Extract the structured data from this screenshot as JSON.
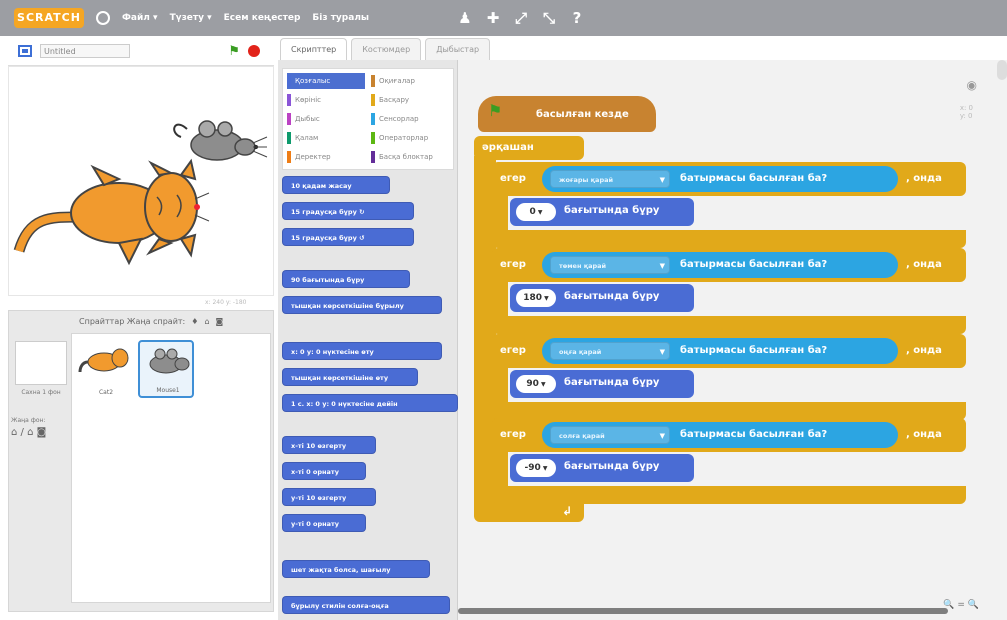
{
  "menubar": {
    "logo": "SCRATCH",
    "items": [
      "Файл ▾",
      "Түзету ▾",
      "Есем кеңестер",
      "Біз туралы"
    ],
    "tool_icons": [
      "duplicate-icon",
      "delete-icon",
      "grow-icon",
      "shrink-icon",
      "help-icon"
    ]
  },
  "stage": {
    "project_name": "Untitled",
    "coords": "x: 240  y: -180"
  },
  "sprite_pane": {
    "header": "Спрайттар  Жаңа спрайт:",
    "stage_label": "Сахна\n1 фон",
    "new_backdrop_label": "Жаңа фон:",
    "sprites": [
      {
        "name": "Cat2",
        "selected": false
      },
      {
        "name": "Mouse1",
        "selected": true
      }
    ]
  },
  "tabs": [
    "Скрипттер",
    "Костюмдер",
    "Дыбыстар"
  ],
  "palette": {
    "categories": [
      {
        "label": "Қозғалыс",
        "color": "#4a6cd4",
        "selected": true
      },
      {
        "label": "Көрініс",
        "color": "#8a55d7",
        "selected": false
      },
      {
        "label": "Дыбыс",
        "color": "#bb42c3",
        "selected": false
      },
      {
        "label": "Қалам",
        "color": "#0e9a6c",
        "selected": false
      },
      {
        "label": "Деректер",
        "color": "#ee7d16",
        "selected": false
      },
      {
        "label": "Оқиғалар",
        "color": "#c88330",
        "selected": false
      },
      {
        "label": "Басқару",
        "color": "#e1a91a",
        "selected": false
      },
      {
        "label": "Сенсорлар",
        "color": "#2ca5e2",
        "selected": false
      },
      {
        "label": "Операторлар",
        "color": "#5cb712",
        "selected": false
      },
      {
        "label": "Басқа блоктар",
        "color": "#632d99",
        "selected": false
      }
    ],
    "blocks": [
      {
        "text": "10 қадам жасау",
        "kind": "motion"
      },
      {
        "text": "15 градусқа бұру ↻",
        "kind": "motion"
      },
      {
        "text": "15 градусқа бұру ↺",
        "kind": "motion"
      },
      {
        "text": "90 бағытында бұру",
        "kind": "motion"
      },
      {
        "text": "тышқан көрсеткішіне бұрылу",
        "kind": "motion"
      },
      {
        "text": "x: 0 y: 0 нүктесіне өту",
        "kind": "motion"
      },
      {
        "text": "тышқан көрсеткішіне өту",
        "kind": "motion"
      },
      {
        "text": "1 с. x: 0 y: 0 нүктесіне дейін",
        "kind": "motion"
      },
      {
        "text": "x-ті 10 өзгерту",
        "kind": "motion"
      },
      {
        "text": "x-ті 0 орнату",
        "kind": "motion"
      },
      {
        "text": "y-ті 10 өзгерту",
        "kind": "motion"
      },
      {
        "text": "y-ті 0 орнату",
        "kind": "motion"
      },
      {
        "text": "шет жақта болса, шағылу",
        "kind": "motion"
      },
      {
        "text": "бұрылу стилін солға-оңға",
        "kind": "motion"
      }
    ]
  },
  "script": {
    "hat": "басылған кезде",
    "forever": "әрқашан",
    "if_word": "егер",
    "then_word": ", онда",
    "condition_text": "батырмасы басылған ба?",
    "point_text": "бағытында бұру",
    "ifs": [
      {
        "key": "жоғары қарай",
        "dir": "0"
      },
      {
        "key": "төмен қарай",
        "dir": "180"
      },
      {
        "key": "оңға қарай",
        "dir": "90"
      },
      {
        "key": "солға қарай",
        "dir": "-90"
      }
    ]
  },
  "colors": {
    "event": "#c88330",
    "control": "#e1a91a",
    "motion": "#4a6cd4",
    "sensing": "#2ca5e2",
    "menubar": "#9c9ea3"
  }
}
